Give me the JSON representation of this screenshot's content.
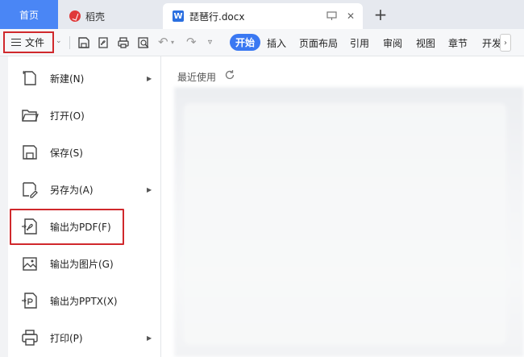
{
  "tabs": {
    "home": "首页",
    "daoke": "稻壳",
    "document": "琵琶行.docx",
    "new_tab_icon": "plus-icon"
  },
  "toolbar": {
    "file_label": "文件",
    "menu_tabs": [
      "开始",
      "插入",
      "页面布局",
      "引用",
      "审阅",
      "视图",
      "章节",
      "开发"
    ],
    "active_tab": "开始",
    "active_color": "#3a78f2",
    "highlight_color": "#d0282c"
  },
  "file_menu": {
    "items": [
      {
        "label": "新建(N)",
        "icon": "new-doc-icon",
        "has_submenu": true
      },
      {
        "label": "打开(O)",
        "icon": "folder-open-icon",
        "has_submenu": false
      },
      {
        "label": "保存(S)",
        "icon": "save-icon",
        "has_submenu": false
      },
      {
        "label": "另存为(A)",
        "icon": "save-as-icon",
        "has_submenu": true
      },
      {
        "label": "输出为PDF(F)",
        "icon": "export-pdf-icon",
        "has_submenu": false,
        "highlighted": true
      },
      {
        "label": "输出为图片(G)",
        "icon": "export-image-icon",
        "has_submenu": false
      },
      {
        "label": "输出为PPTX(X)",
        "icon": "export-pptx-icon",
        "has_submenu": false
      },
      {
        "label": "打印(P)",
        "icon": "print-icon",
        "has_submenu": true
      }
    ]
  },
  "recent": {
    "title": "最近使用"
  }
}
